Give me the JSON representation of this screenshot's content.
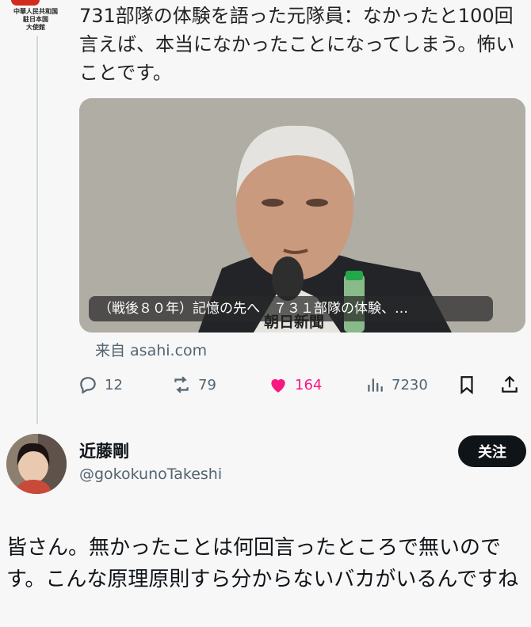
{
  "source_tweet": {
    "account_logo_text": [
      "中華人民共和国",
      "駐日本国",
      "大使館"
    ],
    "text": "731部隊の体験を語った元隊員：なかったと100回言えば、本当になかったことになってしまう。怖いことです。",
    "media": {
      "caption": "（戦後８０年）記憶の先へ　７３１部隊の体験、…",
      "watermark": "朝日新聞"
    },
    "source": "来自 asahi.com",
    "stats": {
      "replies": "12",
      "retweets": "79",
      "likes": "164",
      "views": "7230"
    },
    "icons": [
      "reply-icon",
      "retweet-icon",
      "heart-icon",
      "views-icon",
      "bookmark-icon",
      "share-icon"
    ],
    "colors": {
      "like": "#f91880",
      "muted": "#536471"
    }
  },
  "reply": {
    "display_name": "近藤剛",
    "handle": "@gokokunoTakeshi",
    "follow_label": "关注",
    "text": "皆さん。無かったことは何回言ったところで無いのです。こんな原理原則すら分からないバカがいるんですね"
  }
}
